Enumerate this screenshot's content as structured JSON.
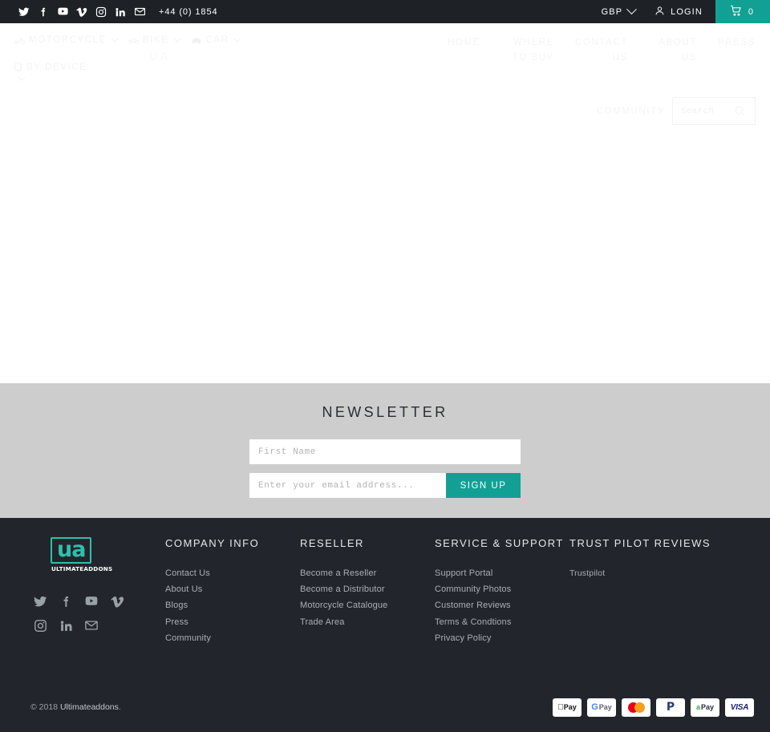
{
  "topbar": {
    "social": [
      {
        "name": "twitter-icon",
        "label": "Twitter"
      },
      {
        "name": "facebook-icon",
        "label": "Facebook"
      },
      {
        "name": "youtube-icon",
        "label": "YouTube"
      },
      {
        "name": "vimeo-icon",
        "label": "Vimeo"
      },
      {
        "name": "instagram-icon",
        "label": "Instagram"
      },
      {
        "name": "linkedin-icon",
        "label": "LinkedIn"
      },
      {
        "name": "email-icon",
        "label": "Email"
      }
    ],
    "phone": "+44 (0) 1854",
    "currency": "GBP",
    "login": "LOGIN",
    "cart_count": "0",
    "cart_accent": "#12a094"
  },
  "header": {
    "ghost_logo": "UA",
    "category_nav": [
      {
        "label": "MOTORCYCLE",
        "icon": "motorcycle-icon",
        "caret": true
      },
      {
        "label": "BIKE",
        "icon": "bicycle-icon",
        "caret": true
      },
      {
        "label": "CAR",
        "icon": "car-icon",
        "caret": true
      }
    ],
    "by_device": {
      "label": "BY DEVICE",
      "icon": "device-icon"
    },
    "main_nav": [
      {
        "label": "HOME"
      },
      {
        "label": "WHERE TO BUY"
      },
      {
        "label": "CONTACT US"
      },
      {
        "label": "ABOUT US"
      },
      {
        "label": "PRESS"
      }
    ],
    "community_label": "COMMUNITY",
    "search": {
      "placeholder": "Search",
      "value": "",
      "icon": "search-icon"
    }
  },
  "newsletter": {
    "title": "NEWSLETTER",
    "first_name_placeholder": "First Name",
    "first_name_value": "",
    "email_placeholder": "Enter your email address...",
    "email_value": "",
    "signup_label": "SIGN UP",
    "background": "#cdcdcd",
    "accent": "#12a094"
  },
  "footer": {
    "background": "#22262c",
    "logo": {
      "mark": "ua",
      "wordmark": "ULTIMATEADDONS",
      "color": "#2fbfae"
    },
    "social": [
      {
        "name": "twitter-icon",
        "label": "Twitter"
      },
      {
        "name": "facebook-icon",
        "label": "Facebook"
      },
      {
        "name": "youtube-icon",
        "label": "YouTube"
      },
      {
        "name": "vimeo-icon",
        "label": "Vimeo"
      },
      {
        "name": "instagram-icon",
        "label": "Instagram"
      },
      {
        "name": "linkedin-icon",
        "label": "LinkedIn"
      },
      {
        "name": "email-icon",
        "label": "Email"
      }
    ],
    "columns": [
      {
        "title": "COMPANY INFO",
        "links": [
          "Contact Us",
          "About Us",
          "Blogs",
          "Press",
          "Community"
        ]
      },
      {
        "title": "RESELLER",
        "links": [
          "Become a Reseller",
          "Become a Distributor",
          "Motorcycle Catalogue",
          "Trade Area"
        ]
      },
      {
        "title": "SERVICE & SUPPORT",
        "links": [
          "Support Portal",
          "Community Photos",
          "Customer Reviews",
          "Terms & Condtions",
          "Privacy Policy"
        ]
      },
      {
        "title": "TRUST PILOT REVIEWS",
        "links": [
          "Trustpilot"
        ]
      }
    ],
    "copyright_prefix": "© 2018 ",
    "copyright_brand": "Ultimateaddons",
    "copyright_suffix": ".",
    "payments": [
      {
        "name": "apple-pay-icon",
        "label": "Pay"
      },
      {
        "name": "google-pay-icon",
        "label": "Pay"
      },
      {
        "name": "mastercard-icon",
        "label": ""
      },
      {
        "name": "paypal-icon",
        "label": ""
      },
      {
        "name": "amazon-pay-icon",
        "label": "Pay"
      },
      {
        "name": "visa-icon",
        "label": "VISA"
      }
    ]
  }
}
